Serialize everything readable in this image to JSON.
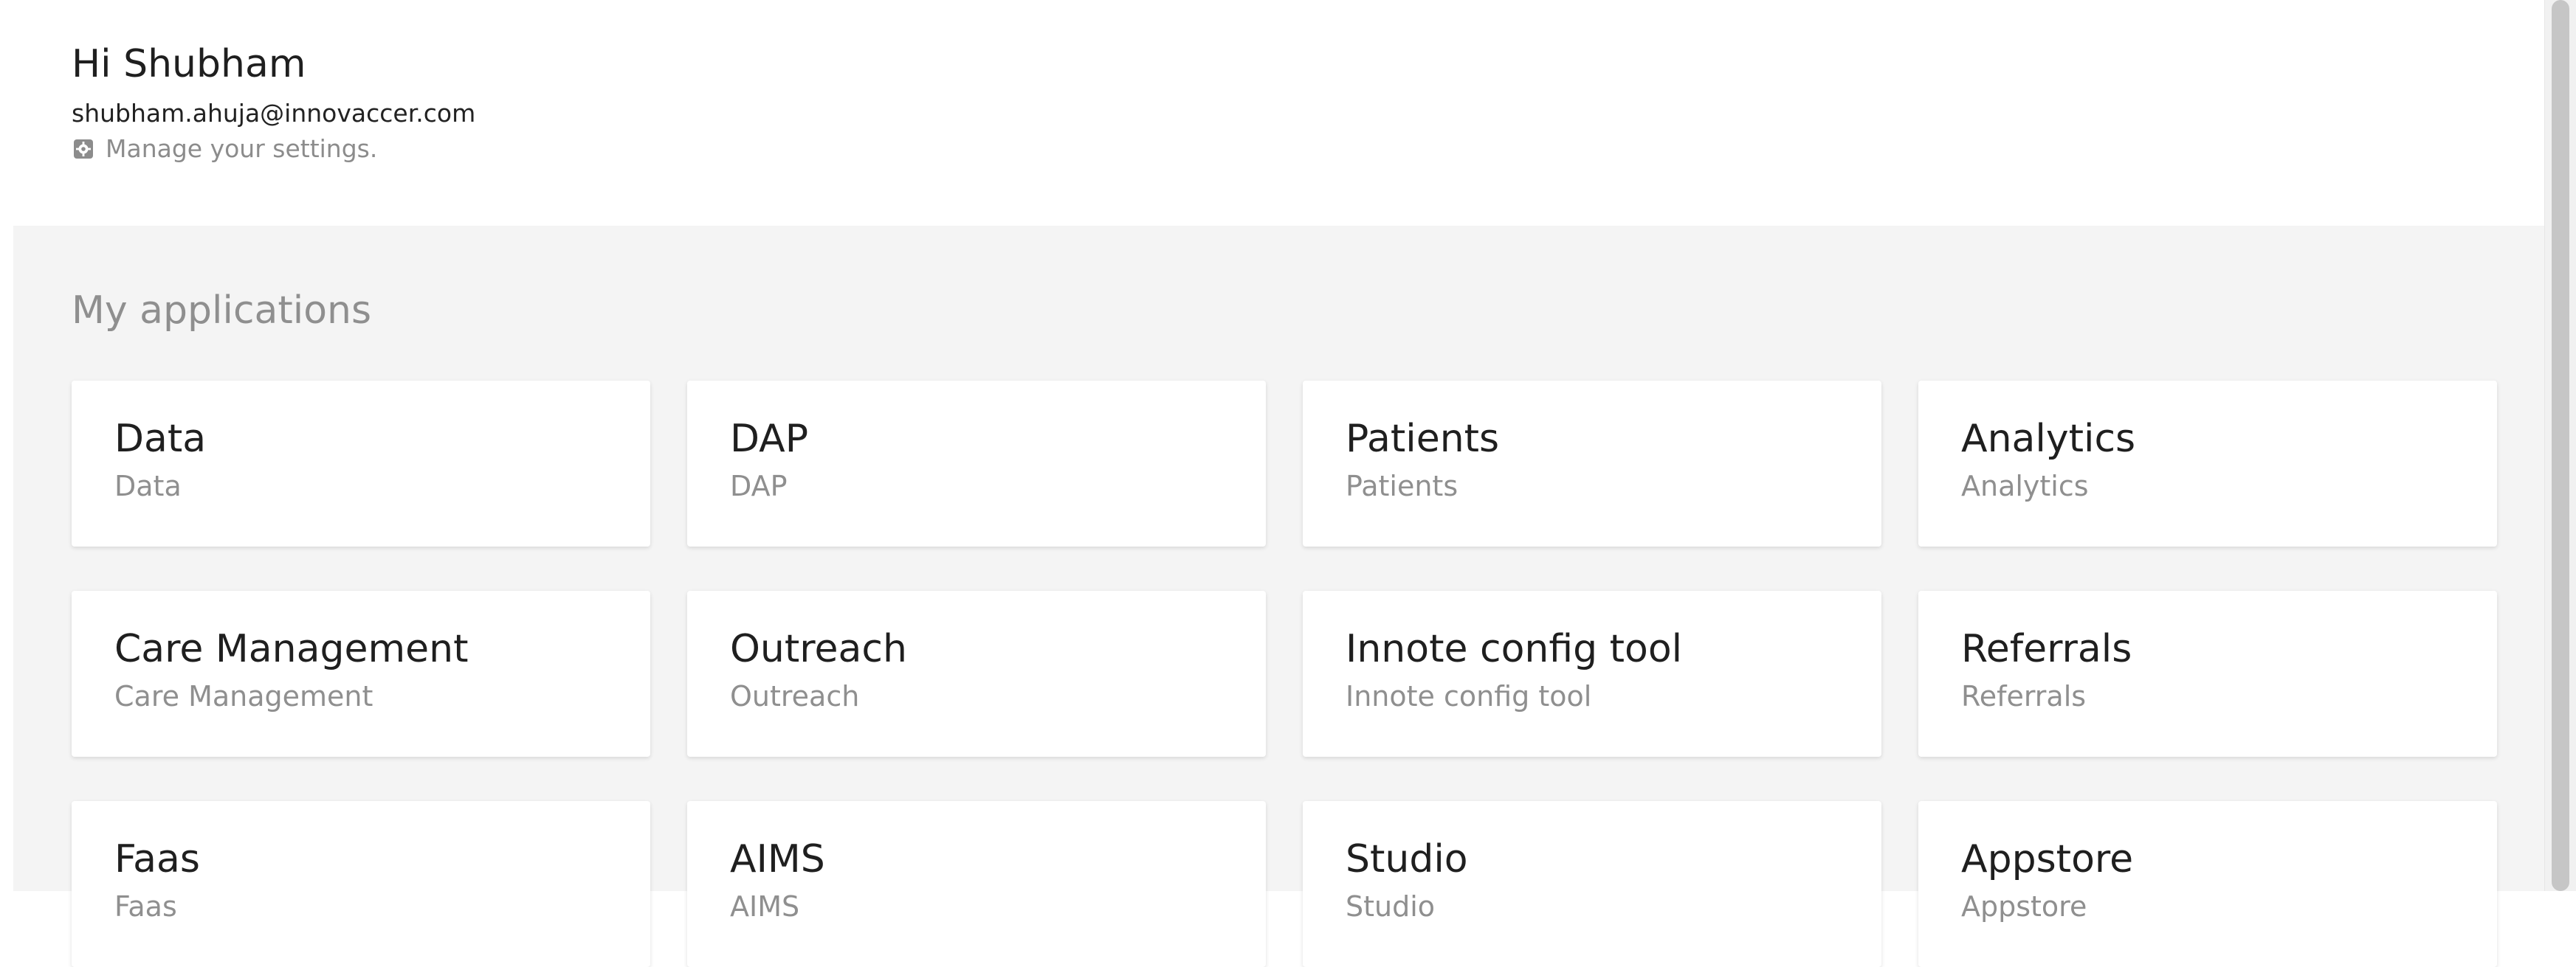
{
  "header": {
    "greeting": "Hi Shubham",
    "email": "shubham.ahuja@innovaccer.com",
    "settings_label": "Manage your settings.",
    "settings_icon": "gear-icon"
  },
  "applications": {
    "title": "My applications",
    "items": [
      {
        "title": "Data",
        "subtitle": "Data"
      },
      {
        "title": "DAP",
        "subtitle": "DAP"
      },
      {
        "title": "Patients",
        "subtitle": "Patients"
      },
      {
        "title": "Analytics",
        "subtitle": "Analytics"
      },
      {
        "title": "Care Management",
        "subtitle": "Care Management"
      },
      {
        "title": "Outreach",
        "subtitle": "Outreach"
      },
      {
        "title": "Innote config tool",
        "subtitle": "Innote config tool"
      },
      {
        "title": "Referrals",
        "subtitle": "Referrals"
      },
      {
        "title": "Faas",
        "subtitle": "Faas"
      },
      {
        "title": "AIMS",
        "subtitle": "AIMS"
      },
      {
        "title": "Studio",
        "subtitle": "Studio"
      },
      {
        "title": "Appstore",
        "subtitle": "Appstore"
      }
    ]
  },
  "colors": {
    "panel_background": "#f4f4f4",
    "card_background": "#ffffff",
    "muted_text": "#8f8f8f",
    "primary_text": "#1f1f1f"
  }
}
